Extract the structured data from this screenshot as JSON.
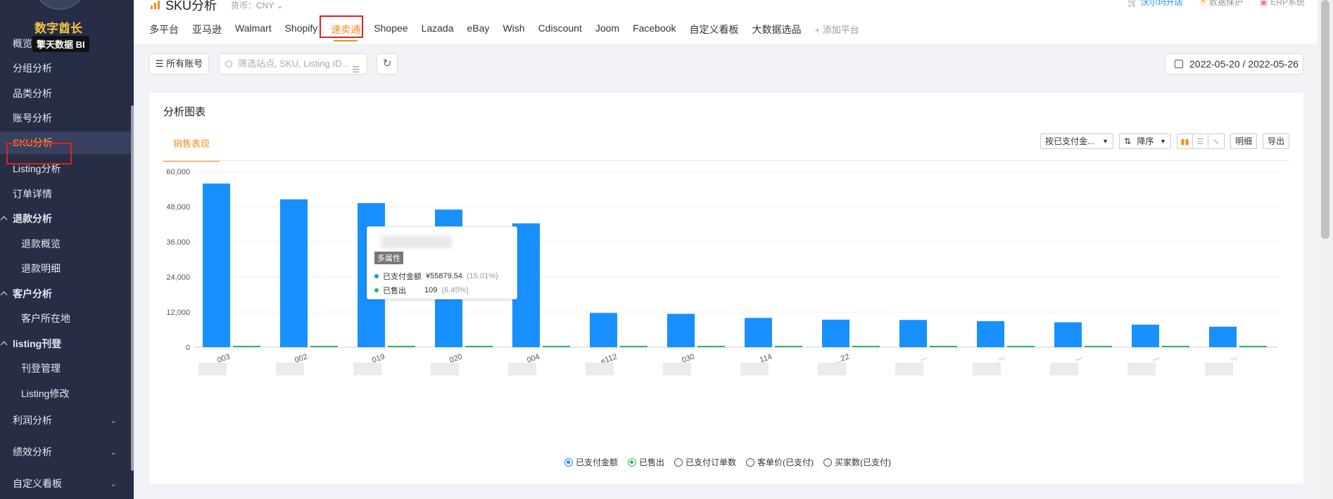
{
  "brand": {
    "title": "数字酋长",
    "subtitle": "擎天数据 BI"
  },
  "sidebar": {
    "items": [
      {
        "label": "概览",
        "type": "top"
      },
      {
        "label": "分组分析",
        "type": "top"
      },
      {
        "label": "品类分析",
        "type": "top"
      },
      {
        "label": "账号分析",
        "type": "top"
      },
      {
        "label": "SKU分析",
        "type": "top",
        "active": true
      },
      {
        "label": "Listing分析",
        "type": "top"
      },
      {
        "label": "订单详情",
        "type": "top"
      },
      {
        "label": "退款分析",
        "type": "group"
      },
      {
        "label": "退款概览",
        "type": "sub"
      },
      {
        "label": "退款明细",
        "type": "sub"
      },
      {
        "label": "客户分析",
        "type": "group"
      },
      {
        "label": "客户所在地",
        "type": "sub"
      },
      {
        "label": "listing刊登",
        "type": "group"
      },
      {
        "label": "刊登管理",
        "type": "sub"
      },
      {
        "label": "Listing修改",
        "type": "sub"
      },
      {
        "label": "利润分析",
        "type": "collapsed"
      },
      {
        "label": "绩效分析",
        "type": "collapsed"
      },
      {
        "label": "自定义看板",
        "type": "collapsed"
      }
    ]
  },
  "header": {
    "page_title": "SKU分析",
    "currency": "货币：CNY ⌄",
    "links": [
      {
        "label": "沃尔玛开店",
        "color": "#1890ff"
      },
      {
        "label": "数据保护",
        "color": "#999999"
      },
      {
        "label": "ERP系统",
        "color": "#999999"
      }
    ]
  },
  "platform_tabs": [
    {
      "label": "多平台"
    },
    {
      "label": "亚马逊"
    },
    {
      "label": "Walmart"
    },
    {
      "label": "Shopify"
    },
    {
      "label": "速卖通",
      "active": true
    },
    {
      "label": "Shopee"
    },
    {
      "label": "Lazada"
    },
    {
      "label": "eBay"
    },
    {
      "label": "Wish"
    },
    {
      "label": "Cdiscount"
    },
    {
      "label": "Joom"
    },
    {
      "label": "Facebook"
    },
    {
      "label": "自定义看板"
    },
    {
      "label": "大数据选品"
    },
    {
      "label": "+ 添加平台",
      "add": true
    }
  ],
  "filters": {
    "accounts_label": "所有账号",
    "search_placeholder": "筛选站点, SKU, Listing ID...",
    "date_range": "2022-05-20 / 2022-05-26"
  },
  "panel": {
    "title": "分析图表",
    "tab": "销售表现",
    "sort_by": "按已支付金...",
    "order": "降序",
    "detail_button": "明细",
    "export_button": "导出"
  },
  "tooltip": {
    "tag": "多属性",
    "rows": [
      {
        "name": "已支付金额",
        "value": "¥55879.54",
        "pct": "(15.01%)",
        "color": "#1890ff"
      },
      {
        "name": "已售出",
        "value": "109",
        "pct": "(6.45%)",
        "color": "#2cb85c"
      }
    ]
  },
  "legend": [
    {
      "label": "已支付金额",
      "state": "blue"
    },
    {
      "label": "已售出",
      "state": "green"
    },
    {
      "label": "已支付订单数",
      "state": "off"
    },
    {
      "label": "客单价(已支付)",
      "state": "off"
    },
    {
      "label": "买家数(已支付)",
      "state": "off"
    }
  ],
  "chart_data": {
    "type": "bar",
    "categories": [
      "003",
      "002",
      "019",
      "020",
      "004",
      "e112",
      "030",
      "114",
      "...22",
      "...",
      "...",
      "...",
      "...",
      "..."
    ],
    "series": [
      {
        "name": "已支付金额",
        "color": "#1890ff",
        "values": [
          55880,
          50500,
          49200,
          47000,
          42300,
          11700,
          11400,
          10000,
          9400,
          9300,
          8900,
          8500,
          7700,
          7000
        ]
      },
      {
        "name": "已售出",
        "color": "#2cb85c",
        "values": [
          109,
          95,
          92,
          88,
          80,
          40,
          38,
          35,
          30,
          28,
          26,
          24,
          20,
          18
        ]
      }
    ],
    "ylim": [
      0,
      60000
    ],
    "yticks": [
      "0",
      "12,000",
      "24,000",
      "36,000",
      "48,000",
      "60,000"
    ],
    "grid": true,
    "legend_position": "bottom"
  }
}
